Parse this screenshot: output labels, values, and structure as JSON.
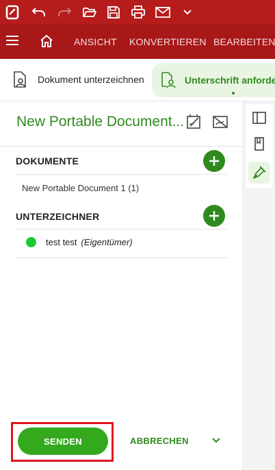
{
  "toolbar": {
    "icons": [
      "app-logo-icon",
      "undo-icon",
      "redo-icon",
      "open-folder-icon",
      "save-icon",
      "print-icon",
      "mail-icon",
      "chevron-down-icon"
    ]
  },
  "menu": {
    "items": [
      {
        "label": "ANSICHT"
      },
      {
        "label": "KONVERTIEREN"
      },
      {
        "label": "BEARBEITEN"
      }
    ]
  },
  "tabs": {
    "sign": "Dokument unterzeichnen",
    "request": "Unterschrift anfordern"
  },
  "panel": {
    "title": "New Portable Document...",
    "documents_header": "DOKUMENTE",
    "document_item": "New Portable Document 1 (1)",
    "signers_header": "UNTERZEICHNER",
    "signer_name": "test test",
    "signer_role": "(Eigentümer)"
  },
  "footer": {
    "send_label": "SENDEN",
    "cancel_label": "ABBRECHEN"
  },
  "colors": {
    "topbar": "#b61c1c",
    "menubar": "#a81818",
    "accent_green": "#2f8a1e",
    "send_green": "#35a91e",
    "status_green": "#1ec936",
    "highlight_red": "#e0141e"
  }
}
